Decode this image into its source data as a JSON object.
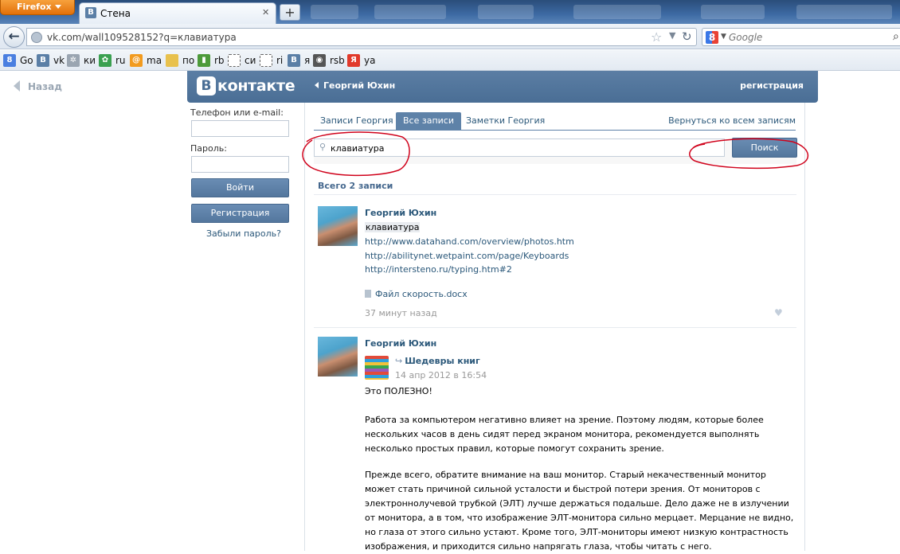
{
  "browser": {
    "menu_button": "Firefox",
    "tab_title": "Стена",
    "tab_favicon": "B",
    "url": "vk.com/wall109528152?q=клавиатура",
    "search_placeholder": "Google",
    "bookmarks": [
      {
        "label": "Go",
        "icon": "google-icon",
        "color": "#4a7fe0",
        "glyph": "8"
      },
      {
        "label": "vk",
        "icon": "vk-icon",
        "color": "#5b7fa6",
        "glyph": "B"
      },
      {
        "label": "ки",
        "icon": "film-reel-icon",
        "color": "#9aa5b1",
        "glyph": "✲"
      },
      {
        "label": "ru",
        "icon": "flower-icon",
        "color": "#3aa050",
        "glyph": "✿"
      },
      {
        "label": "ma",
        "icon": "mail-at-icon",
        "color": "#f29b1f",
        "glyph": "@"
      },
      {
        "label": "по",
        "icon": "folder-icon",
        "color": "#e8c14d",
        "glyph": ""
      },
      {
        "label": "rb",
        "icon": "rbc-chart-icon",
        "color": "#4c9a3a",
        "glyph": "▮"
      },
      {
        "label": "си",
        "icon": "dashed-box-icon",
        "color": "#ffffff",
        "glyph": ""
      },
      {
        "label": "ri",
        "icon": "dashed-box-icon",
        "color": "#ffffff",
        "glyph": ""
      },
      {
        "label": "я",
        "icon": "vk-icon",
        "color": "#5b7fa6",
        "glyph": "B"
      },
      {
        "label": "rsb",
        "icon": "globe-icon",
        "color": "#555555",
        "glyph": "◉"
      },
      {
        "label": "ya",
        "icon": "yandex-icon",
        "color": "#e13a2b",
        "glyph": "Я"
      }
    ]
  },
  "page": {
    "back_link": "Назад",
    "header": {
      "logo_letter": "B",
      "logo_word": "контакте",
      "profile_name": "Георгий Юхин",
      "register_link": "регистрация"
    },
    "login": {
      "phone_label": "Телефон или e-mail:",
      "password_label": "Пароль:",
      "login_button": "Войти",
      "register_button": "Регистрация",
      "forgot_link": "Забыли пароль?"
    },
    "tabs": [
      {
        "label": "Записи Георгия",
        "active": false
      },
      {
        "label": "Все записи",
        "active": true
      },
      {
        "label": "Заметки Георгия",
        "active": false
      }
    ],
    "back_to_all": "Вернуться ко всем записям",
    "search": {
      "value": "клавиатура",
      "button": "Поиск"
    },
    "total": "Всего 2 записи",
    "posts": [
      {
        "author": "Георгий Юхин",
        "highlight": "клавиатура",
        "links": [
          "http://www.datahand.com/overview/photos.htm",
          "http://abilitynet.wetpaint.com/page/Keyboards",
          "http://intersteno.ru/typing.htm#2"
        ],
        "file": "Файл скорость.docx",
        "time": "37 минут назад"
      },
      {
        "author": "Георгий Юхин",
        "repost_from": "Шедевры книг",
        "repost_date": "14 апр 2012 в 16:54",
        "paragraphs": [
          "Это ПОЛЕЗНО!",
          "Работа за компьютером негативно влияет на зрение. Поэтому людям, которые более нескольких часов в день сидят перед экраном монитора, рекомендуется выполнять несколько простых правил, которые помогут сохранить зрение.",
          "Прежде всего, обратите внимание на ваш монитор. Старый некачественный монитор может стать причиной сильной усталости и быстрой потери зрения. От мониторов с электроннолучевой трубкой (ЭЛТ) лучше держаться подальше. Дело даже не в излучении от монитора, а в том, что изображение ЭЛТ-монитора сильно мерцает. Мерцание не видно, но глаза от этого сильно устают. Кроме того, ЭЛТ-мониторы имеют низкую контрастность изображения, и приходится сильно напрягать глаза, чтобы читать с него."
        ]
      }
    ]
  },
  "colors": {
    "vk_blue": "#5b7ea4",
    "link": "#2b587a",
    "annotation_red": "#d0021b"
  }
}
